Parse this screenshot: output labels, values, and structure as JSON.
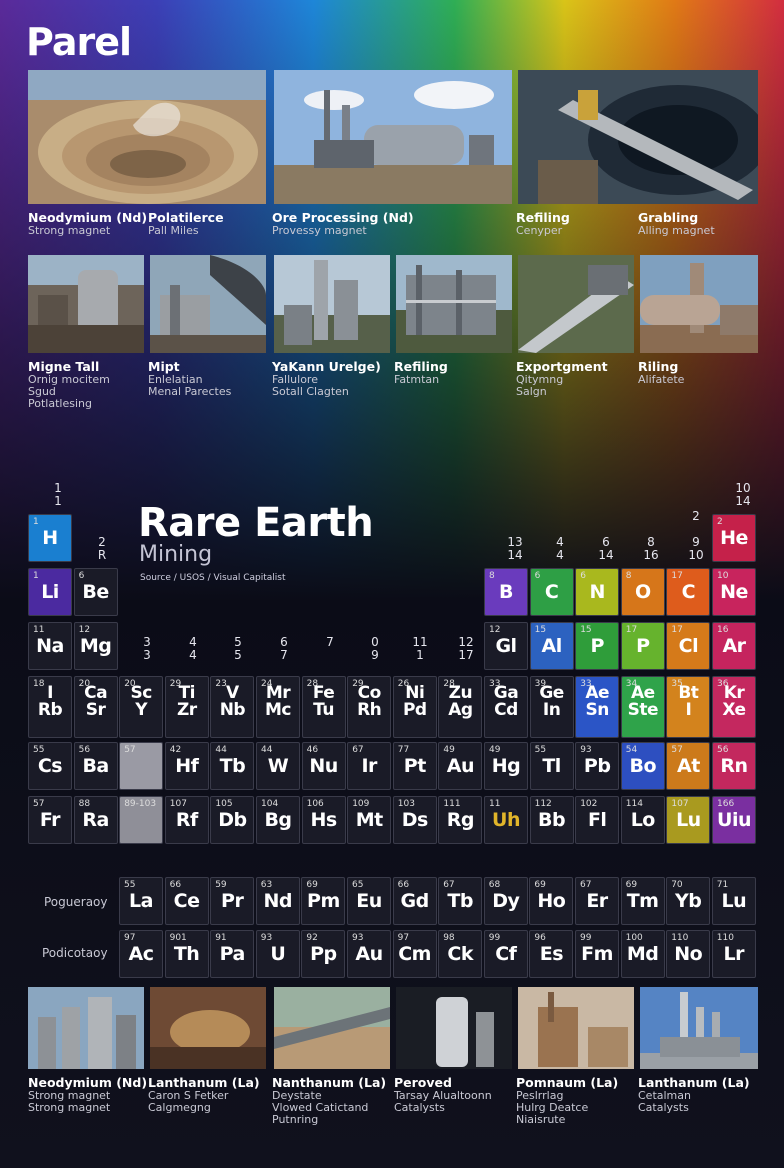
{
  "brand": "Parel",
  "top_row": [
    {
      "title": "Neodymium (Nd)",
      "sub": [
        "Strong magnet"
      ]
    },
    {
      "title": "Polatilerce",
      "sub": [
        "Pall Miles"
      ]
    },
    {
      "title": "Ore Processing (Nd)",
      "sub": [
        "Provessy magnet"
      ]
    },
    {
      "title": "Refiling",
      "sub": [
        "Cenyper"
      ]
    },
    {
      "title": "Grabling",
      "sub": [
        "Alling magnet"
      ]
    }
  ],
  "second_row": [
    {
      "title": "Migne Tall",
      "sub": [
        "Ornig mocitem",
        "Sgud",
        "Potlatlesing"
      ]
    },
    {
      "title": "Mipt",
      "sub": [
        "Enlelatian",
        "Menal Parectes"
      ]
    },
    {
      "title": "YaKann Urelge)",
      "sub": [
        "Fallulore",
        "Sotall Clagten"
      ]
    },
    {
      "title": "Refiling",
      "sub": [
        "Fatmtan"
      ]
    },
    {
      "title": "Exportgment",
      "sub": [
        "Qitymng",
        "Salgn"
      ]
    },
    {
      "title": "Riling",
      "sub": [
        "Alifatete"
      ]
    }
  ],
  "table": {
    "title": "Rare Earth",
    "subtitle": "Mining",
    "source": "Source / USOS / Visual Capitalist",
    "group_numbers": [
      {
        "t": "1\n1"
      },
      {
        "t": "2\nR"
      },
      {
        "t": "3\n3"
      },
      {
        "t": "4\n4"
      },
      {
        "t": "5\n5"
      },
      {
        "t": "6\n7"
      },
      {
        "t": "7"
      },
      {
        "t": "0\n9"
      },
      {
        "t": "11\n1"
      },
      {
        "t": "12\n17"
      },
      {
        "t": "13\n14"
      },
      {
        "t": "4\n4"
      },
      {
        "t": "6\n14"
      },
      {
        "t": "8\n16"
      },
      {
        "t": "9\n10"
      },
      {
        "t": "2"
      },
      {
        "t": "10\n14"
      }
    ],
    "rows": [
      [
        {
          "n": "1",
          "s": "H",
          "c": "#1a7fd0",
          "col": 0,
          "row": 0
        }
      ],
      [
        {
          "n": "2",
          "s": "He",
          "c": "#c5214a",
          "col": 15,
          "row": 0
        }
      ],
      [
        {
          "n": "1",
          "s": "Li",
          "c": "#4b2aa0",
          "col": 0,
          "row": 1
        },
        {
          "n": "6",
          "s": "Be",
          "c": "#1a1b27",
          "col": 1,
          "row": 1
        },
        {
          "n": "8",
          "s": "B",
          "c": "#6a3bbd",
          "col": 10,
          "row": 1
        },
        {
          "n": "6",
          "s": "C",
          "c": "#2e9f45",
          "col": 11,
          "row": 1
        },
        {
          "n": "6",
          "s": "N",
          "c": "#a9b81e",
          "col": 12,
          "row": 1
        },
        {
          "n": "8",
          "s": "O",
          "c": "#d6761a",
          "col": 13,
          "row": 1
        },
        {
          "n": "17",
          "s": "C",
          "c": "#de5c1c",
          "col": 14,
          "row": 1
        },
        {
          "n": "10",
          "s": "Ne",
          "c": "#c8245d",
          "col": 15,
          "row": 1
        }
      ],
      [
        {
          "n": "11",
          "s": "Na",
          "c": "#1a1b27",
          "col": 0,
          "row": 2
        },
        {
          "n": "12",
          "s": "Mg",
          "c": "#1a1b27",
          "col": 1,
          "row": 2
        },
        {
          "n": "12",
          "s": "Gl",
          "c": "#1a1b27",
          "col": 10,
          "row": 2
        },
        {
          "n": "15",
          "s": "Al",
          "c": "#2c62c0",
          "col": 11,
          "row": 2
        },
        {
          "n": "15",
          "s": "P",
          "c": "#2f9d3a",
          "col": 12,
          "row": 2
        },
        {
          "n": "17",
          "s": "P",
          "c": "#66b32d",
          "col": 13,
          "row": 2
        },
        {
          "n": "17",
          "s": "Cl",
          "c": "#d57a1a",
          "col": 14,
          "row": 2
        },
        {
          "n": "16",
          "s": "Ar",
          "c": "#c5245e",
          "col": 15,
          "row": 2
        }
      ],
      [
        {
          "n": "18",
          "s": "I\nRb",
          "c": "#1a1b27",
          "col": 0,
          "row": 3
        },
        {
          "n": "20",
          "s": "Ca\nSr",
          "c": "#1a1b27",
          "col": 1,
          "row": 3
        },
        {
          "n": "20",
          "s": "Sc\nY",
          "c": "#1a1b27",
          "col": 2,
          "row": 3
        },
        {
          "n": "29",
          "s": "Ti\nZr",
          "c": "#1a1b27",
          "col": 3,
          "row": 3
        },
        {
          "n": "23",
          "s": "V\nNb",
          "c": "#1a1b27",
          "col": 4,
          "row": 3
        },
        {
          "n": "24",
          "s": "Mr\nMc",
          "c": "#1a1b27",
          "col": 5,
          "row": 3
        },
        {
          "n": "28",
          "s": "Fe\nTu",
          "c": "#1a1b27",
          "col": 6,
          "row": 3
        },
        {
          "n": "29",
          "s": "Co\nRh",
          "c": "#1a1b27",
          "col": 7,
          "row": 3
        },
        {
          "n": "26",
          "s": "Ni\nPd",
          "c": "#1a1b27",
          "col": 8,
          "row": 3
        },
        {
          "n": "28",
          "s": "Zu\nAg",
          "c": "#1a1b27",
          "col": 9,
          "row": 3
        },
        {
          "n": "33",
          "s": "Ga\nCd",
          "c": "#1a1b27",
          "col": 10,
          "row": 3
        },
        {
          "n": "39",
          "s": "Ge\nIn",
          "c": "#1a1b27",
          "col": 11,
          "row": 3
        },
        {
          "n": "33",
          "s": "Ae\nSn",
          "c": "#2b55c6",
          "col": 12,
          "row": 3
        },
        {
          "n": "34",
          "s": "Ae\nSte",
          "c": "#2fa34a",
          "col": 13,
          "row": 3
        },
        {
          "n": "35",
          "s": "Bt\nI",
          "c": "#d3831d",
          "col": 14,
          "row": 3
        },
        {
          "n": "36",
          "s": "Kr\nXe",
          "c": "#c4285f",
          "col": 15,
          "row": 3
        }
      ],
      [
        {
          "n": "55",
          "s": "Cs",
          "c": "#1a1b27",
          "col": 0,
          "row": 4
        },
        {
          "n": "56",
          "s": "Ba",
          "c": "#1a1b27",
          "col": 1,
          "row": 4
        },
        {
          "n": "57",
          "s": "",
          "c": "#9a9aa4",
          "col": 2,
          "row": 4
        },
        {
          "n": "42",
          "s": "Hf",
          "c": "#1a1b27",
          "col": 3,
          "row": 4
        },
        {
          "n": "44",
          "s": "Tb",
          "c": "#1a1b27",
          "col": 4,
          "row": 4
        },
        {
          "n": "44",
          "s": "W",
          "c": "#1a1b27",
          "col": 5,
          "row": 4
        },
        {
          "n": "46",
          "s": "Nu",
          "c": "#1a1b27",
          "col": 6,
          "row": 4
        },
        {
          "n": "67",
          "s": "Ir",
          "c": "#1a1b27",
          "col": 7,
          "row": 4
        },
        {
          "n": "77",
          "s": "Pt",
          "c": "#1a1b27",
          "col": 8,
          "row": 4
        },
        {
          "n": "49",
          "s": "Au",
          "c": "#1a1b27",
          "col": 9,
          "row": 4
        },
        {
          "n": "49",
          "s": "Hg",
          "c": "#1a1b27",
          "col": 10,
          "row": 4
        },
        {
          "n": "55",
          "s": "Tl",
          "c": "#1a1b27",
          "col": 11,
          "row": 4
        },
        {
          "n": "93",
          "s": "Pb",
          "c": "#1a1b27",
          "col": 12,
          "row": 4
        },
        {
          "n": "54",
          "s": "Bo",
          "c": "#2d4fc0",
          "col": 13,
          "row": 4
        },
        {
          "n": "57",
          "s": "At",
          "c": "#cc7a1b",
          "col": 14,
          "row": 4
        },
        {
          "n": "56",
          "s": "Rn",
          "c": "#c3285e",
          "col": 15,
          "row": 4
        }
      ],
      [
        {
          "n": "57",
          "s": "Fr",
          "c": "#1a1b27",
          "col": 0,
          "row": 5
        },
        {
          "n": "88",
          "s": "Ra",
          "c": "#1a1b27",
          "col": 1,
          "row": 5
        },
        {
          "n": "89-103",
          "s": "",
          "c": "#8f8f98",
          "col": 2,
          "row": 5
        },
        {
          "n": "107",
          "s": "Rf",
          "c": "#1a1b27",
          "col": 3,
          "row": 5
        },
        {
          "n": "105",
          "s": "Db",
          "c": "#1a1b27",
          "col": 4,
          "row": 5
        },
        {
          "n": "104",
          "s": "Bg",
          "c": "#1a1b27",
          "col": 5,
          "row": 5
        },
        {
          "n": "106",
          "s": "Hs",
          "c": "#1a1b27",
          "col": 6,
          "row": 5
        },
        {
          "n": "109",
          "s": "Mt",
          "c": "#1a1b27",
          "col": 7,
          "row": 5
        },
        {
          "n": "103",
          "s": "Ds",
          "c": "#1a1b27",
          "col": 8,
          "row": 5
        },
        {
          "n": "111",
          "s": "Rg",
          "c": "#1a1b27",
          "col": 9,
          "row": 5
        },
        {
          "n": "11",
          "s": "Uh",
          "c": "#1a1b27",
          "col": 10,
          "row": 5,
          "gold": true
        },
        {
          "n": "112",
          "s": "Bb",
          "c": "#1a1b27",
          "col": 11,
          "row": 5
        },
        {
          "n": "102",
          "s": "Fl",
          "c": "#1a1b27",
          "col": 12,
          "row": 5
        },
        {
          "n": "114",
          "s": "Lo",
          "c": "#1a1b27",
          "col": 13,
          "row": 5
        },
        {
          "n": "107",
          "s": "Lu",
          "c": "#a99a1f",
          "col": 14,
          "row": 5
        },
        {
          "n": "166",
          "s": "Uiu",
          "c": "#7a2fa0",
          "col": 15,
          "row": 5
        }
      ]
    ],
    "lanth_label": "Pogueraoy",
    "actin_label": "Podicotaoy",
    "lanthanides": [
      {
        "n": "55",
        "s": "La"
      },
      {
        "n": "66",
        "s": "Ce"
      },
      {
        "n": "59",
        "s": "Pr"
      },
      {
        "n": "63",
        "s": "Nd"
      },
      {
        "n": "69",
        "s": "Pm"
      },
      {
        "n": "65",
        "s": "Eu"
      },
      {
        "n": "66",
        "s": "Gd"
      },
      {
        "n": "67",
        "s": "Tb"
      },
      {
        "n": "68",
        "s": "Dy"
      },
      {
        "n": "69",
        "s": "Ho"
      },
      {
        "n": "67",
        "s": "Er"
      },
      {
        "n": "69",
        "s": "Tm"
      },
      {
        "n": "70",
        "s": "Yb"
      },
      {
        "n": "71",
        "s": "Lu"
      }
    ],
    "actinides": [
      {
        "n": "97",
        "s": "Ac"
      },
      {
        "n": "901",
        "s": "Th"
      },
      {
        "n": "91",
        "s": "Pa"
      },
      {
        "n": "93",
        "s": "U"
      },
      {
        "n": "92",
        "s": "Pp"
      },
      {
        "n": "93",
        "s": "Au"
      },
      {
        "n": "97",
        "s": "Cm"
      },
      {
        "n": "98",
        "s": "Ck"
      },
      {
        "n": "99",
        "s": "Cf"
      },
      {
        "n": "96",
        "s": "Es"
      },
      {
        "n": "99",
        "s": "Fm"
      },
      {
        "n": "100",
        "s": "Md"
      },
      {
        "n": "110",
        "s": "No"
      },
      {
        "n": "110",
        "s": "Lr"
      }
    ]
  },
  "bottom_row": [
    {
      "title": "Neodymium (Nd)",
      "sub": [
        "Strong magnet",
        "Strong magnet"
      ]
    },
    {
      "title": "Lanthanum (La)",
      "sub": [
        "Caron S Fetker",
        "Calgmegng"
      ]
    },
    {
      "title": "Nanthanum (La)",
      "sub": [
        "Deystate",
        "Vlowed Catictand",
        "Putnring"
      ]
    },
    {
      "title": "Peroved",
      "sub": [
        "Tarsay Alualtoonn",
        "Catalysts"
      ]
    },
    {
      "title": "Pomnaum (La)",
      "sub": [
        "Peslrrlag",
        "Hulrg Deatce",
        "Niaisrute"
      ]
    },
    {
      "title": "Lanthanum (La)",
      "sub": [
        "Cetalman",
        "Catalysts"
      ]
    }
  ]
}
